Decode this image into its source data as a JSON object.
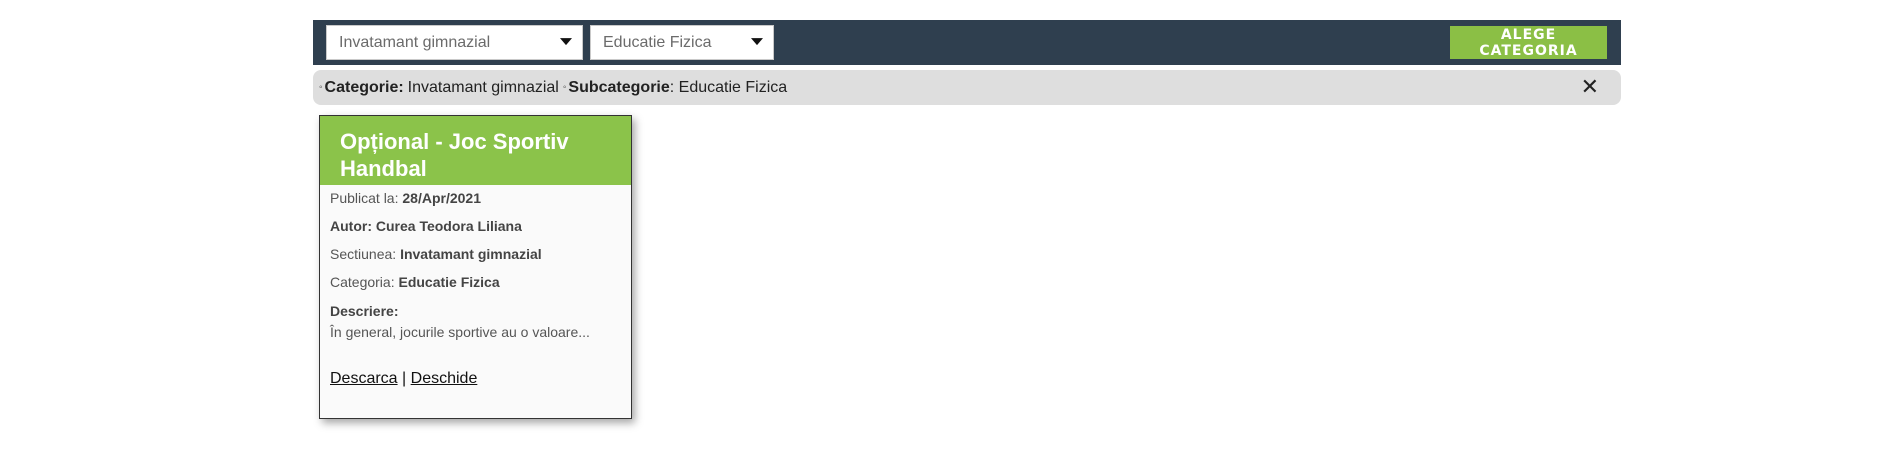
{
  "toolbar": {
    "category_select": {
      "value": "Invatamant gimnazial"
    },
    "subcategory_select": {
      "value": "Educatie Fizica"
    },
    "choose_button": "ALEGE CATEGORIA",
    "accent_color": "#8bbf45",
    "background_color": "#2f3f4f"
  },
  "filter": {
    "category_label": "Categorie:",
    "category_value": "Invatamant gimnazial",
    "subcategory_label": "Subcategorie",
    "subcategory_value": ": Educatie Fizica",
    "close_symbol": "✕"
  },
  "card": {
    "title": "Opțional - Joc Sportiv Handbal",
    "published_label": "Publicat la:",
    "published_value": "28/Apr/2021",
    "author": "Autor: Curea Teodora Liliana",
    "section_label": "Sectiunea:",
    "section_value": "Invatamant gimnazial",
    "category_label": "Categoria:",
    "category_value": "Educatie Fizica",
    "description_label": "Descriere:",
    "description_text": "În general, jocurile sportive au o valoare...",
    "download_link": "Descarca",
    "separator": "|",
    "open_link": "Deschide",
    "header_color": "#8bc34a"
  }
}
